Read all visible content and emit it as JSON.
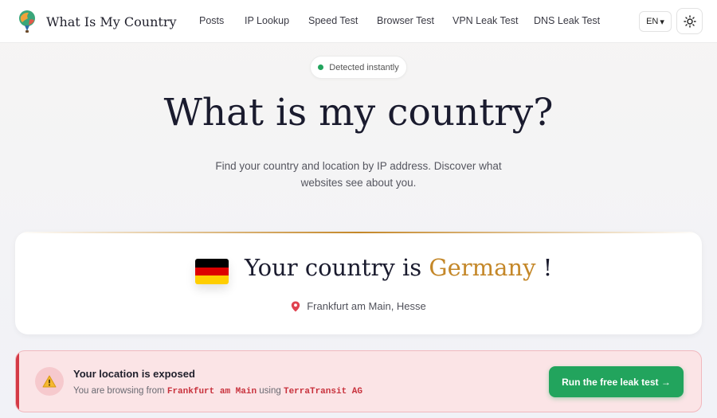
{
  "header": {
    "brand": "What Is My Country",
    "nav": [
      "Posts",
      "IP Lookup",
      "Speed Test",
      "Browser Test",
      "VPN Leak Test",
      "DNS Leak Test"
    ],
    "language": "EN",
    "language_caret": "▾"
  },
  "hero": {
    "badge": "Detected instantly",
    "title": "What is my country?",
    "subtitle": "Find your country and location by IP address. Discover what websites see about you."
  },
  "country_card": {
    "prefix": "Your country is",
    "country": "Germany",
    "suffix": "!",
    "location": "Frankfurt am Main, Hesse",
    "flag_colors": [
      "#000000",
      "#dd0000",
      "#ffce00"
    ]
  },
  "alert": {
    "title": "Your location is exposed",
    "text_prefix": "You are browsing from",
    "city": "Frankfurt am Main",
    "text_mid": "using",
    "isp": "TerraTransit AG",
    "button": "Run the free leak test →"
  },
  "colors": {
    "accent": "#c48728",
    "success": "#22a45d",
    "danger": "#d43a46"
  }
}
